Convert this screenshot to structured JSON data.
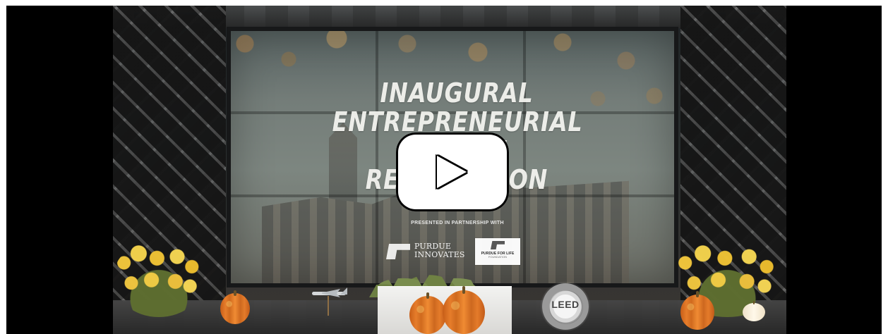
{
  "video": {
    "title_lines": [
      "INAUGURAL",
      "ENTREPRENEURIAL",
      "ALUMNI RECOGNITION"
    ],
    "partnership_text": "PRESENTED IN PARTNERSHIP WITH",
    "logos": {
      "purdue_innovates_top": "PURDUE",
      "purdue_innovates_bottom": "INNOVATES",
      "purdue_for_life_name": "PURDUE FOR LIFE",
      "purdue_for_life_sub": "FOUNDATION"
    },
    "leed_label": "LEED",
    "play_button_icon": "play-icon"
  },
  "colors": {
    "page_background": "#ffffff",
    "player_background": "#000000",
    "play_button_fill": "#ffffff",
    "play_button_outline": "#000000",
    "flower_yellow": "#f1c63c",
    "pumpkin_orange": "#e67d2b"
  }
}
